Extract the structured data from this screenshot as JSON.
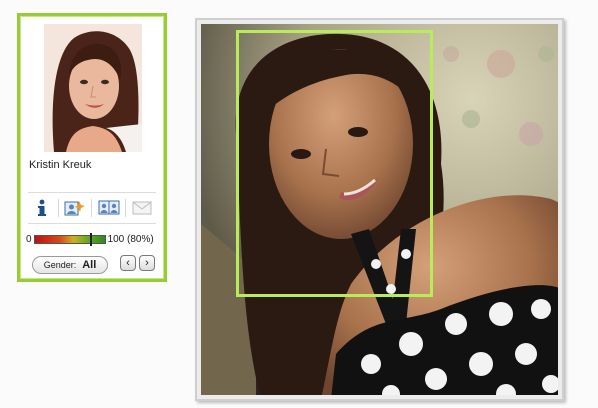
{
  "card": {
    "name": "Kristin Kreuk",
    "score_min": "0",
    "score_max_label": "100 (80%)",
    "score_percent": 80,
    "gender_label": "Gender:",
    "gender_value": "All"
  },
  "icons": [
    "info-icon",
    "match-icon",
    "compare-icon",
    "mail-icon"
  ],
  "colors": {
    "card_border": "#99cc33",
    "face_box": "#b8ec58"
  }
}
